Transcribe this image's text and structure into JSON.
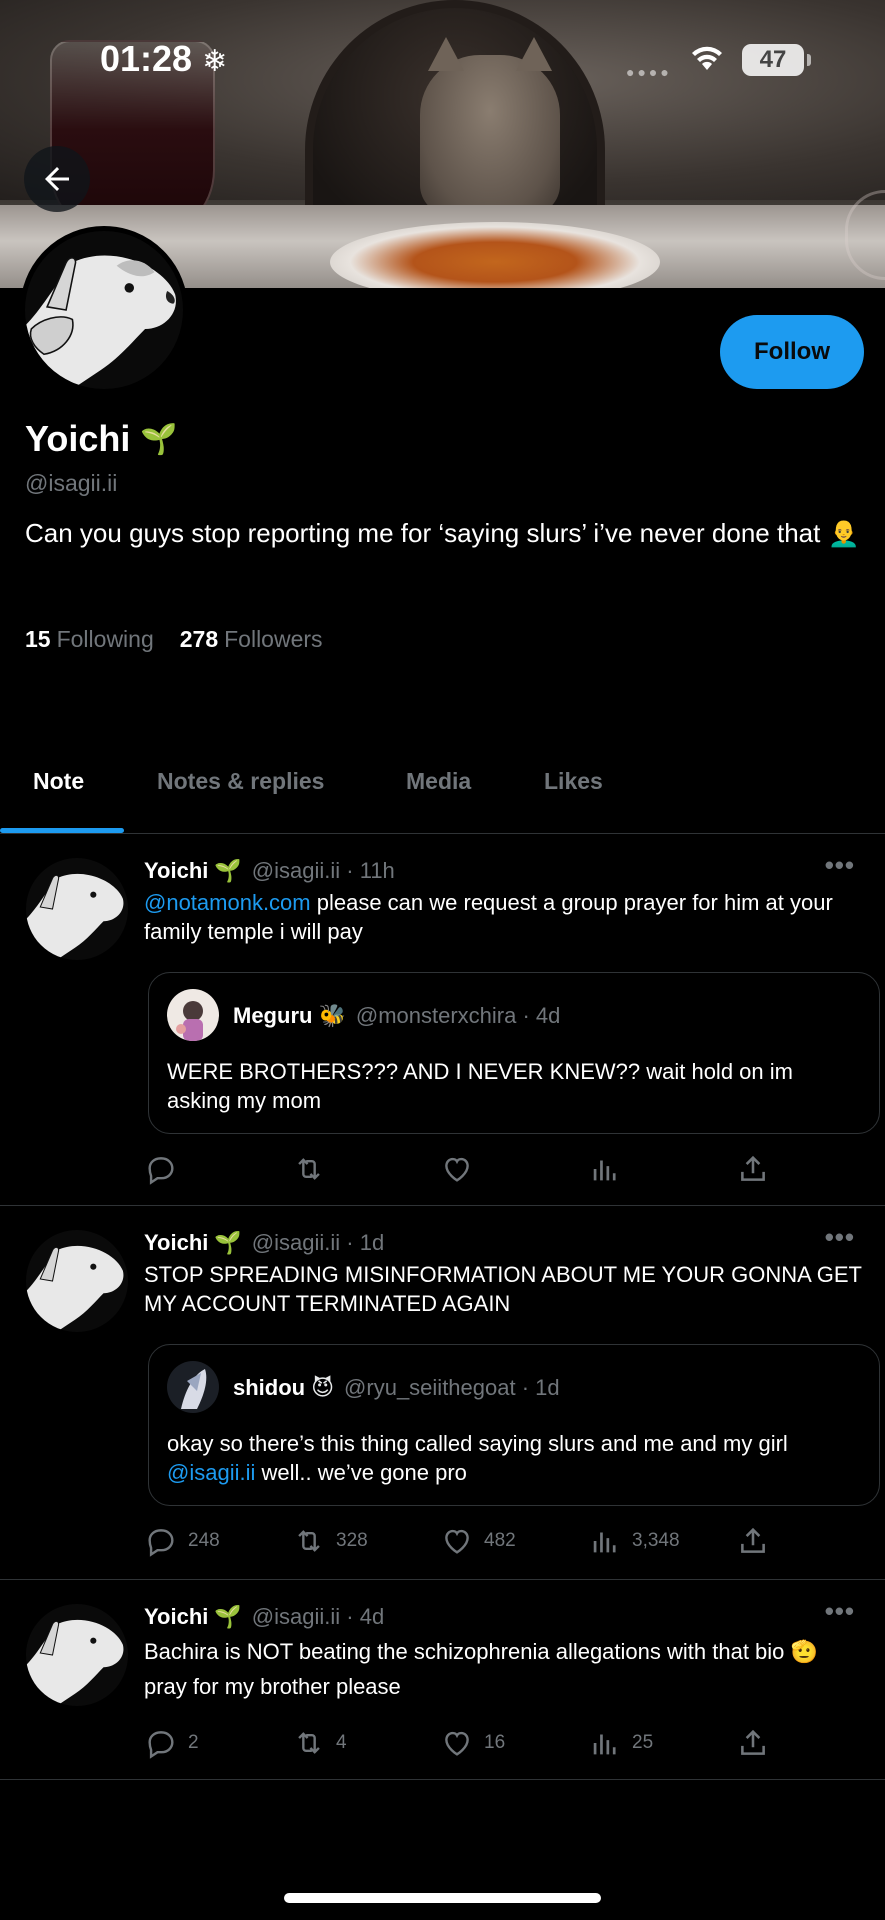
{
  "status_bar": {
    "time": "01:28",
    "time_icon": "snowflake-icon",
    "battery": "47"
  },
  "profile": {
    "name": "Yoichi",
    "name_emoji": "🌱",
    "handle": "@isagii.ii",
    "bio": "Can you guys stop reporting me for ‘saying slurs’ i’ve never done that 👨‍🦲",
    "following_count": "15",
    "following_label": "Following",
    "followers_count": "278",
    "followers_label": "Followers",
    "follow_button": "Follow"
  },
  "tabs": [
    {
      "label": "Note",
      "active": true
    },
    {
      "label": "Notes & replies",
      "active": false
    },
    {
      "label": "Media",
      "active": false
    },
    {
      "label": "Likes",
      "active": false
    }
  ],
  "posts": [
    {
      "author": "Yoichi",
      "emoji": "🌱",
      "handle": "@isagii.ii",
      "time": "11h",
      "mention": "@notamonk.com",
      "text": " please can we request a group prayer for him at your family temple i will pay",
      "quote": {
        "author": "Meguru",
        "emoji": "🐝",
        "handle": "@monsterxchira",
        "time": "4d",
        "text": "WERE BROTHERS??? AND I NEVER KNEW?? wait hold on im asking my mom"
      },
      "stats": {
        "replies": "",
        "reposts": "",
        "likes": "",
        "views": ""
      }
    },
    {
      "author": "Yoichi",
      "emoji": "🌱",
      "handle": "@isagii.ii",
      "time": "1d",
      "text": "STOP SPREADING MISINFORMATION ABOUT ME YOUR GONNA GET MY ACCOUNT TERMINATED AGAIN",
      "quote": {
        "author": "shidou",
        "emoji": "😈",
        "handle": "@ryu_seiithegoat",
        "time": "1d",
        "text_before": "okay so there’s this thing called saying slurs and me and my girl ",
        "mention": "@isagii.ii",
        "text_after": " well.. we’ve gone pro"
      },
      "stats": {
        "replies": "248",
        "reposts": "328",
        "likes": "482",
        "views": "3,348"
      }
    },
    {
      "author": "Yoichi",
      "emoji": "🌱",
      "handle": "@isagii.ii",
      "time": "4d",
      "text": "Bachira is NOT beating the schizophrenia allegations with that bio 🫡 pray for my brother please",
      "stats": {
        "replies": "2",
        "reposts": "4",
        "likes": "16",
        "views": "25"
      }
    }
  ],
  "colors": {
    "accent": "#1d9bf0",
    "background": "#000000",
    "muted": "#71767b"
  }
}
